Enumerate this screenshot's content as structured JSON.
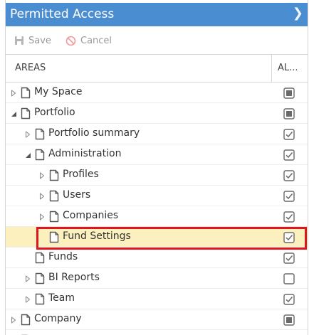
{
  "panel": {
    "title": "Permitted Access",
    "expand_icon": "chevron-right-icon"
  },
  "toolbar": {
    "save_label": "Save",
    "cancel_label": "Cancel"
  },
  "columns": {
    "areas": "AREAS",
    "all": "AL..."
  },
  "rows": [
    {
      "label": "My Space",
      "expander": "collapsed",
      "check": "partial"
    },
    {
      "label": "Portfolio",
      "expander": "expanded",
      "check": "partial"
    },
    {
      "label": "Portfolio summary",
      "expander": "collapsed",
      "check": "checked"
    },
    {
      "label": "Administration",
      "expander": "expanded",
      "check": "checked"
    },
    {
      "label": "Profiles",
      "expander": "collapsed",
      "check": "checked"
    },
    {
      "label": "Users",
      "expander": "collapsed",
      "check": "checked"
    },
    {
      "label": "Companies",
      "expander": "collapsed",
      "check": "checked"
    },
    {
      "label": "Fund Settings",
      "expander": "none",
      "check": "checked",
      "selected": true,
      "highlighted": true
    },
    {
      "label": "Funds",
      "expander": "none",
      "check": "checked"
    },
    {
      "label": "BI Reports",
      "expander": "collapsed",
      "check": "unchecked"
    },
    {
      "label": "Team",
      "expander": "collapsed",
      "check": "checked"
    },
    {
      "label": "Company",
      "expander": "collapsed",
      "check": "partial"
    }
  ],
  "colors": {
    "header_bg": "#4a8dd1",
    "selected_row": "#fdf0bf",
    "highlight_border": "#e0161f"
  }
}
